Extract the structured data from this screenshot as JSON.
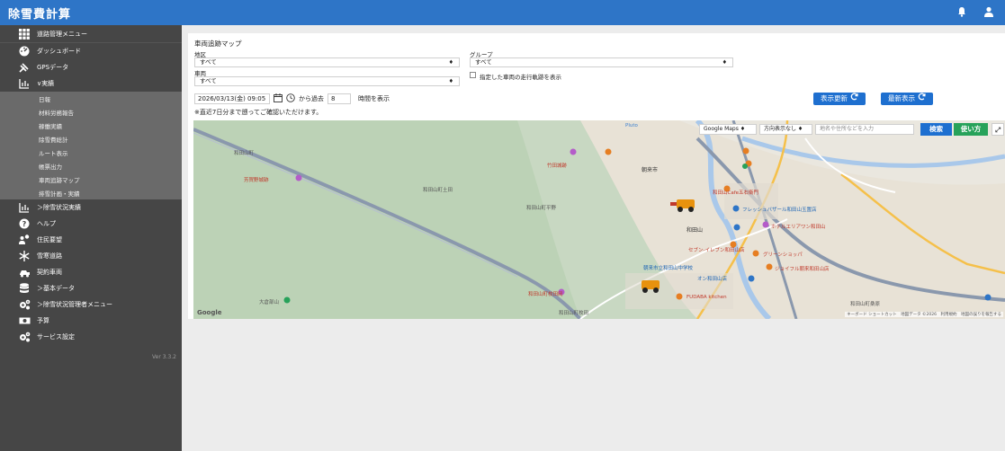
{
  "app": {
    "title": "除雪費計算"
  },
  "header": {
    "icons": [
      "bell-icon",
      "user-icon"
    ]
  },
  "sidebar": {
    "items": [
      {
        "label": "道路管理メニュー",
        "icon": "grid-icon"
      },
      {
        "label": "ダッシュボード",
        "icon": "dashboard-icon"
      },
      {
        "label": "GPSデータ",
        "icon": "satellite-icon"
      },
      {
        "label": "∨実績",
        "icon": "bar-chart-icon"
      }
    ],
    "submenu": [
      "日報",
      "材料労務報告",
      "稼働実績",
      "除雪費総計",
      "ルート表示",
      "帳票出力",
      "車両追跡マップ",
      "排雪計画・実績"
    ],
    "items2": [
      {
        "label": "＞除雪状況実績",
        "icon": "bar-chart-icon"
      },
      {
        "label": "ヘルプ",
        "icon": "help-icon"
      },
      {
        "label": "住民要望",
        "icon": "people-icon"
      },
      {
        "label": "雪寒道路",
        "icon": "snowflake-icon"
      },
      {
        "label": "契約車両",
        "icon": "vehicle-icon"
      },
      {
        "label": "＞基本データ",
        "icon": "database-icon"
      },
      {
        "label": "＞除雪状況管理者メニュー",
        "icon": "gears-icon"
      },
      {
        "label": "予算",
        "icon": "money-icon"
      },
      {
        "label": "サービス設定",
        "icon": "gears-icon"
      }
    ],
    "version": "Ver 3.3.2"
  },
  "page": {
    "title": "車両追跡マップ",
    "area_label": "地区",
    "area_value": "すべて",
    "group_label": "グループ",
    "group_value": "すべて",
    "vehicle_label": "車両",
    "vehicle_value": "すべて",
    "track_label": "指定した車両の走行軌跡を表示",
    "datetime": "2026/03/13(金) 09:05",
    "from_past": "から過去",
    "hours_value": "8",
    "hours_suffix": "時間を表示",
    "note": "※直近7日分まで遡ってご確認いただけます。",
    "refresh_button": "表示更新",
    "latest_button": "最新表示"
  },
  "map": {
    "maptype": "Google Maps",
    "direction": "方向表示なし",
    "search_placeholder": "地名や住所などを入力",
    "search_button": "検索",
    "howto_button": "使い方",
    "labels": {
      "wadayama_town": "和田山町",
      "hoshizen": "芳賀野城跡",
      "wadayama_doi": "和田山町土田",
      "wadayama_hirano": "和田山町平野",
      "asago": "朝来市",
      "wadayama_yanase": "和田山町枚田",
      "wadayama_shrine": "和田山町桑原",
      "ooh": "大倉部山",
      "wadayama_mukaibata": "和田山町枚田岡",
      "wadayama_eki": "和田山",
      "takeda": "竹田城跡",
      "kitchen": "FUDABA kitchen",
      "hotel": "ホテルエリアワン和田山",
      "green": "グリーンショッパ",
      "cafe": "和田山Cafe五右衛門",
      "aeon": "オン和田山店",
      "junior": "朝来市立和田山中学校",
      "fresh": "フレッシュバザール和田山玉置店",
      "sakura": "セブン-イレブン和田山店",
      "joyful": "ジョイフル朝来和田山店"
    },
    "google": "Google",
    "attribution": "キーボード ショートカット　地図データ ©2026　利用規約　地図の誤りを報告する",
    "north_label": "Pluto"
  },
  "colors": {
    "accent": "#2e75c7",
    "button": "#1e6fcf",
    "search": "#1d6fd0",
    "howto": "#27a25a",
    "sidebar": "#464646",
    "submenu": "#6a6a6a"
  }
}
